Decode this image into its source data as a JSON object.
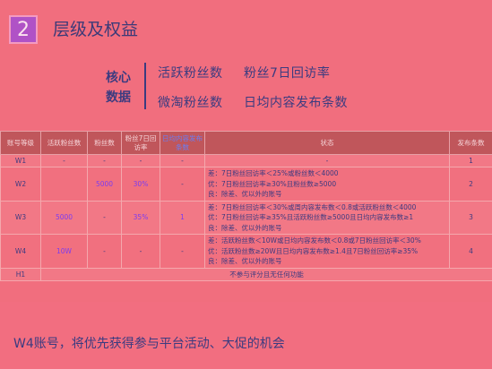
{
  "header": {
    "section_number": "2",
    "title": "层级及权益"
  },
  "core": {
    "label_line1": "核心",
    "label_line2": "数据",
    "metrics": [
      "活跃粉丝数",
      "粉丝7日回访率",
      "微淘粉丝数",
      "日均内容发布条数"
    ]
  },
  "table": {
    "headers": [
      "账号等级",
      "活跃粉丝数",
      "粉丝数",
      "粉丝7日回访率",
      "日均内容发布条数",
      "状态",
      "发布条数"
    ],
    "rows": [
      {
        "level": "W1",
        "active": "-",
        "fans": "-",
        "revisit": "-",
        "daily": "-",
        "status": [
          "-"
        ],
        "count": "1"
      },
      {
        "level": "W2",
        "active": "",
        "fans": "5000",
        "revisit": "30%",
        "daily": "-",
        "status": [
          "差：7日粉丝回访率＜25%或粉丝数＜4000",
          "优：7日粉丝回访率≥30%且粉丝数≥5000",
          "良：除差、优以外的账号"
        ],
        "count": "2"
      },
      {
        "level": "W3",
        "active": "5000",
        "fans": "-",
        "revisit": "35%",
        "daily": "1",
        "status": [
          "差：7日粉丝回访率＜30%或周内容发布数＜0.8或活跃粉丝数＜4000",
          "优：7日粉丝回访率≥35%且活跃粉丝数≥5000且日均内容发布数≥1",
          "良：除差、优以外的账号"
        ],
        "count": "3"
      },
      {
        "level": "W4",
        "active": "10W",
        "fans": "-",
        "revisit": "-",
        "daily": "-",
        "status": [
          "差：活跃粉丝数＜10W或日均内容发布数＜0.8或7日粉丝回访率＜30%",
          "优：活跃粉丝数≥20W且日均内容发布数≥1.4且7日粉丝回访率≥35%",
          "良：除差、优以外的账号"
        ],
        "count": "4"
      },
      {
        "level": "H1",
        "active": "",
        "fans": "",
        "revisit": "",
        "daily": "",
        "status": [
          "不参与评分且无任何功能"
        ],
        "count": ""
      }
    ]
  },
  "footer": {
    "note": "W4账号，将优先获得参与平台活动、大促的机会"
  },
  "colors": {
    "background": "#f16e7e",
    "header_row": "#c0565b",
    "text": "#3b3b80",
    "highlight": "#7c3cf0",
    "badge": "#b052c6"
  }
}
